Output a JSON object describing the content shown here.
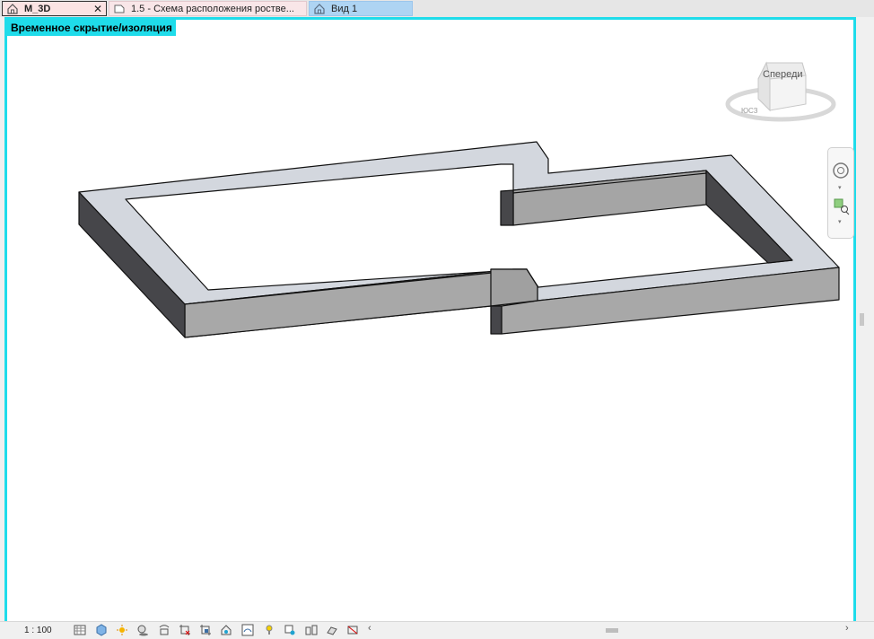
{
  "tabs": [
    {
      "label": "M_3D",
      "icon": "home-3d-icon",
      "close": "✕",
      "active": true
    },
    {
      "label": "1.5 - Схема расположения роствe...",
      "icon": "sheet-icon"
    },
    {
      "label": "Вид 1",
      "icon": "home-3d-icon"
    }
  ],
  "viewport": {
    "isolation_label": "Временное скрытие/изоляция",
    "border_color": "#1fdcea"
  },
  "viewcube": {
    "face_label": "Спереди"
  },
  "statusbar": {
    "scale": "1 : 100",
    "icons": [
      "detail-level-icon",
      "visual-style-icon",
      "sun-path-icon",
      "shadows-icon",
      "crop-view-icon",
      "show-crop-icon",
      "unlock-3d-icon",
      "temp-hide-icon",
      "reveal-hidden-icon",
      "analytical-model-icon",
      "highlight-displacement-icon",
      "worksharing-icon",
      "reveal-constraints-icon",
      "design-options-icon"
    ]
  },
  "colors": {
    "top_face": "#d3d7de",
    "front_face": "#a5a5a5",
    "side_face": "#48484a",
    "edge": "#111111"
  }
}
